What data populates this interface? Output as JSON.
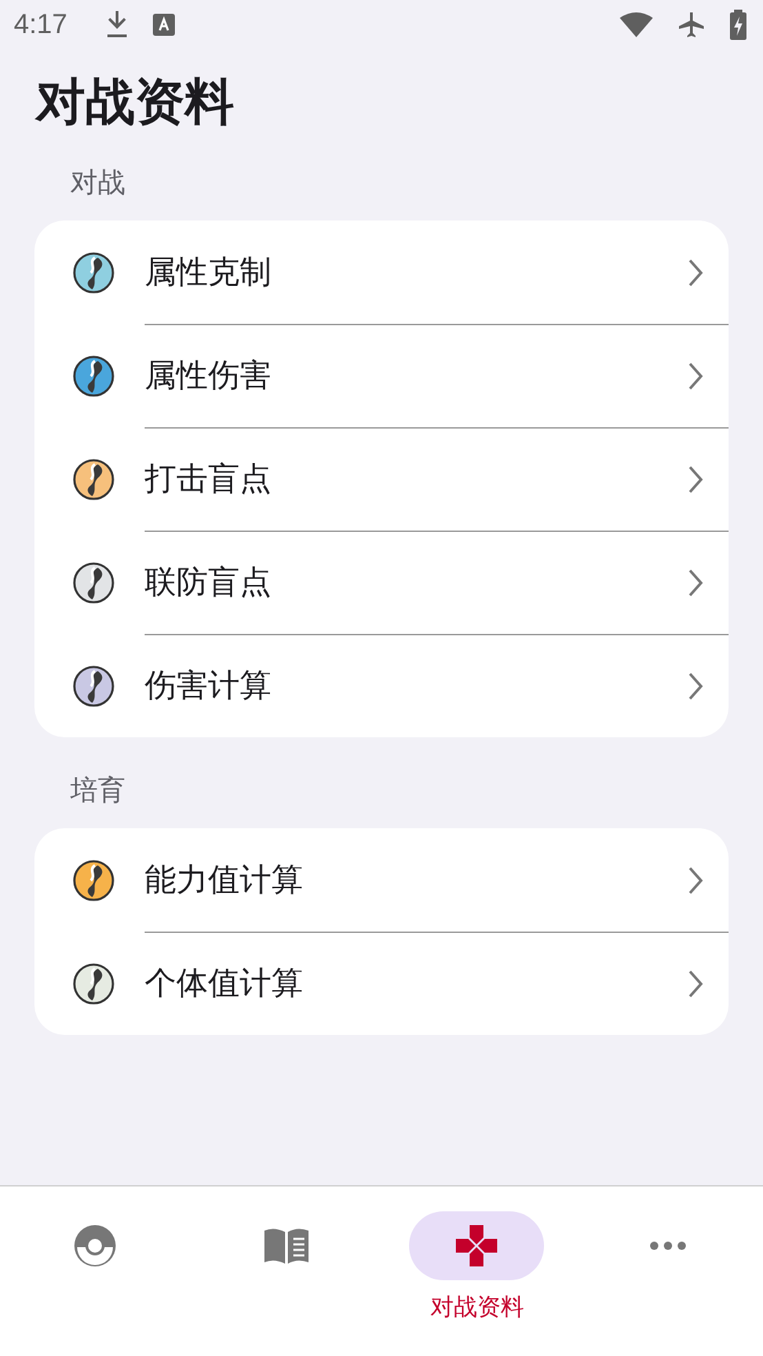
{
  "status_bar": {
    "time": "4:17"
  },
  "title": "对战资料",
  "sections": [
    {
      "label": "对战",
      "items": [
        {
          "label": "属性克制",
          "color": "#8fcfe0"
        },
        {
          "label": "属性伤害",
          "color": "#4aa6dc"
        },
        {
          "label": "打击盲点",
          "color": "#f6c07c"
        },
        {
          "label": "联防盲点",
          "color": "#e2e4e6"
        },
        {
          "label": "伤害计算",
          "color": "#c9c8e4"
        }
      ]
    },
    {
      "label": "培育",
      "items": [
        {
          "label": "能力值计算",
          "color": "#f6b24a"
        },
        {
          "label": "个体值计算",
          "color": "#e6ebe2"
        }
      ]
    }
  ],
  "nav": [
    {
      "kind": "ball",
      "selected": false
    },
    {
      "kind": "book",
      "selected": false
    },
    {
      "kind": "dpad",
      "selected": true,
      "label": "对战资料"
    },
    {
      "kind": "more",
      "selected": false
    }
  ]
}
